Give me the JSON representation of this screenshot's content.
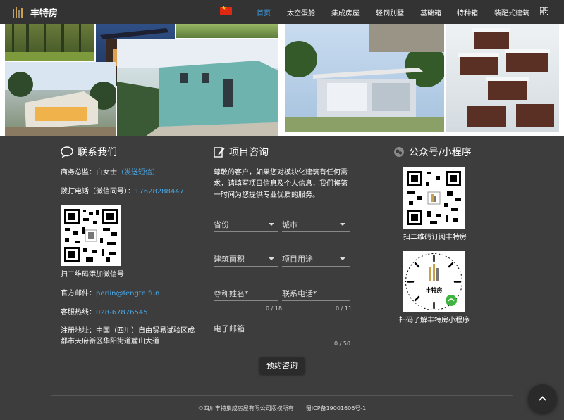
{
  "header": {
    "brand": "丰特房",
    "nav": [
      "首页",
      "太空蛋舱",
      "集成房屋",
      "轻钢别墅",
      "基础箱",
      "特种箱",
      "装配式建筑"
    ],
    "active_index": 0,
    "accent": "#3aa0e8"
  },
  "contact": {
    "title": "联系我们",
    "manager_label": "商务总监：白女士",
    "sms_link": "（发送短信）",
    "phone_label": "拨打电话（微信同号）：",
    "phone": "17628288447",
    "wechat_caption": "扫二维码添加微信号",
    "email_label": "官方邮件：",
    "email": "perlin@fengte.fun",
    "hotline_label": "客服热线：",
    "hotline": "028-67876545",
    "address": "注册地址：中国（四川）自由贸易试验区成都市天府新区华阳街道麓山大道"
  },
  "inquiry": {
    "title": "项目咨询",
    "intro": "尊敬的客户，如果您对模块化建筑有任何需求，请填写项目信息及个人信息，我们将第一时间为您提供专业优质的服务。",
    "province": "省份",
    "city": "城市",
    "area": "建筑面积",
    "usage": "项目用途",
    "name": "尊称姓名*",
    "name_count": "0 / 18",
    "tel": "联系电话*",
    "tel_count": "0 / 11",
    "email": "电子邮箱",
    "email_count": "0 / 50",
    "submit": "预约咨询"
  },
  "official": {
    "title": "公众号/小程序",
    "sub_caption": "扫二维码订阅丰特房",
    "mini_caption": "扫码了解丰特房小程序",
    "mini_brand": "丰特房"
  },
  "footer": {
    "copyright": "©四川丰特集成房屋有限公司版权所有",
    "icp": "蜀ICP备19001606号-1"
  }
}
